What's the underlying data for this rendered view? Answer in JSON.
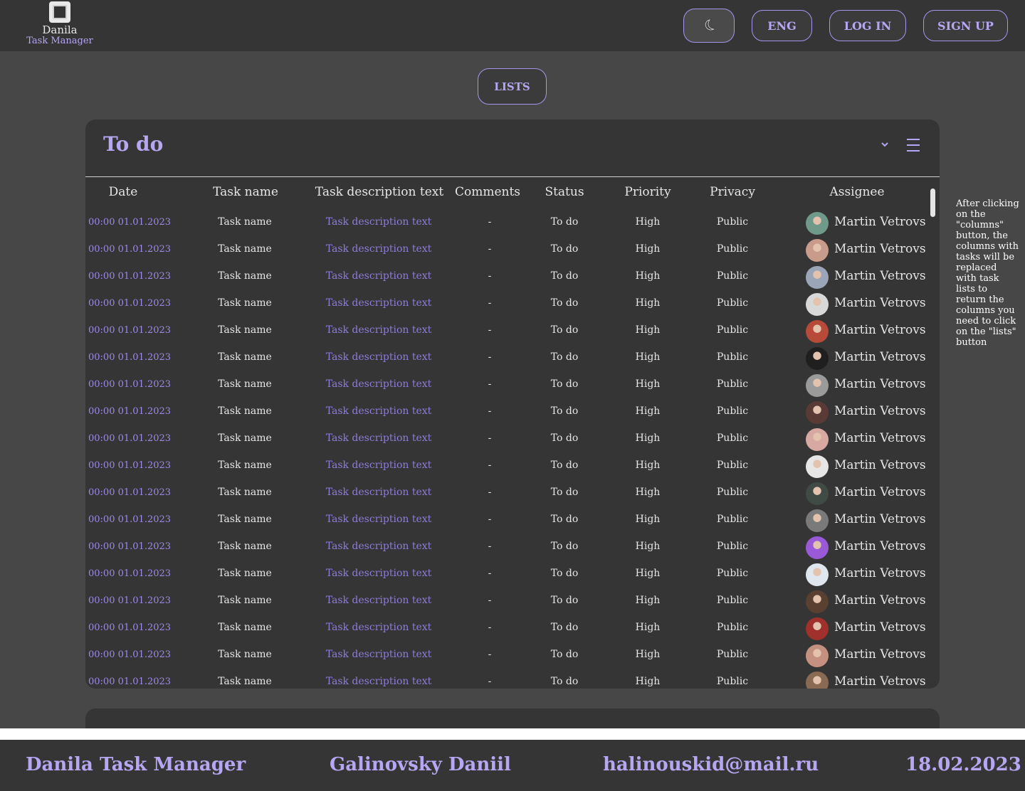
{
  "header": {
    "logo_name": "Danila",
    "logo_sub": "Task Manager",
    "lang_label": "ENG",
    "login_label": "LOG IN",
    "signup_label": "SIGN UP",
    "theme_icon": "moon-icon"
  },
  "lists_button": "LISTS",
  "panel": {
    "title": "To do",
    "columns": {
      "date": "Date",
      "name": "Task name",
      "desc": "Task description text",
      "comments": "Comments",
      "status": "Status",
      "priority": "Priority",
      "privacy": "Privacy",
      "assignee": "Assignee"
    },
    "rows": [
      {
        "date": "00:00 01.01.2023",
        "name": "Task name",
        "desc": "Task description text",
        "comments": "-",
        "status": "To do",
        "priority": "High",
        "privacy": "Public",
        "assignee": "Martin Vetrovs",
        "avatar_color": "#6f9a8a"
      },
      {
        "date": "00:00 01.01.2023",
        "name": "Task name",
        "desc": "Task description text",
        "comments": "-",
        "status": "To do",
        "priority": "High",
        "privacy": "Public",
        "assignee": "Martin Vetrovs",
        "avatar_color": "#c99b8a"
      },
      {
        "date": "00:00 01.01.2023",
        "name": "Task name",
        "desc": "Task description text",
        "comments": "-",
        "status": "To do",
        "priority": "High",
        "privacy": "Public",
        "assignee": "Martin Vetrovs",
        "avatar_color": "#9aa6b8"
      },
      {
        "date": "00:00 01.01.2023",
        "name": "Task name",
        "desc": "Task description text",
        "comments": "-",
        "status": "To do",
        "priority": "High",
        "privacy": "Public",
        "assignee": "Martin Vetrovs",
        "avatar_color": "#d8d8d8"
      },
      {
        "date": "00:00 01.01.2023",
        "name": "Task name",
        "desc": "Task description text",
        "comments": "-",
        "status": "To do",
        "priority": "High",
        "privacy": "Public",
        "assignee": "Martin Vetrovs",
        "avatar_color": "#b84a3a"
      },
      {
        "date": "00:00 01.01.2023",
        "name": "Task name",
        "desc": "Task description text",
        "comments": "-",
        "status": "To do",
        "priority": "High",
        "privacy": "Public",
        "assignee": "Martin Vetrovs",
        "avatar_color": "#1f1f1f"
      },
      {
        "date": "00:00 01.01.2023",
        "name": "Task name",
        "desc": "Task description text",
        "comments": "-",
        "status": "To do",
        "priority": "High",
        "privacy": "Public",
        "assignee": "Martin Vetrovs",
        "avatar_color": "#9a9a9a"
      },
      {
        "date": "00:00 01.01.2023",
        "name": "Task name",
        "desc": "Task description text",
        "comments": "-",
        "status": "To do",
        "priority": "High",
        "privacy": "Public",
        "assignee": "Martin Vetrovs",
        "avatar_color": "#5a3a34"
      },
      {
        "date": "00:00 01.01.2023",
        "name": "Task name",
        "desc": "Task description text",
        "comments": "-",
        "status": "To do",
        "priority": "High",
        "privacy": "Public",
        "assignee": "Martin Vetrovs",
        "avatar_color": "#d7a9a2"
      },
      {
        "date": "00:00 01.01.2023",
        "name": "Task name",
        "desc": "Task description text",
        "comments": "-",
        "status": "To do",
        "priority": "High",
        "privacy": "Public",
        "assignee": "Martin Vetrovs",
        "avatar_color": "#e6e6e6"
      },
      {
        "date": "00:00 01.01.2023",
        "name": "Task name",
        "desc": "Task description text",
        "comments": "-",
        "status": "To do",
        "priority": "High",
        "privacy": "Public",
        "assignee": "Martin Vetrovs",
        "avatar_color": "#3f4b44"
      },
      {
        "date": "00:00 01.01.2023",
        "name": "Task name",
        "desc": "Task description text",
        "comments": "-",
        "status": "To do",
        "priority": "High",
        "privacy": "Public",
        "assignee": "Martin Vetrovs",
        "avatar_color": "#7a7a7a"
      },
      {
        "date": "00:00 01.01.2023",
        "name": "Task name",
        "desc": "Task description text",
        "comments": "-",
        "status": "To do",
        "priority": "High",
        "privacy": "Public",
        "assignee": "Martin Vetrovs",
        "avatar_color": "#9a5ad8"
      },
      {
        "date": "00:00 01.01.2023",
        "name": "Task name",
        "desc": "Task description text",
        "comments": "-",
        "status": "To do",
        "priority": "High",
        "privacy": "Public",
        "assignee": "Martin Vetrovs",
        "avatar_color": "#dfe6ee"
      },
      {
        "date": "00:00 01.01.2023",
        "name": "Task name",
        "desc": "Task description text",
        "comments": "-",
        "status": "To do",
        "priority": "High",
        "privacy": "Public",
        "assignee": "Martin Vetrovs",
        "avatar_color": "#5a4030"
      },
      {
        "date": "00:00 01.01.2023",
        "name": "Task name",
        "desc": "Task description text",
        "comments": "-",
        "status": "To do",
        "priority": "High",
        "privacy": "Public",
        "assignee": "Martin Vetrovs",
        "avatar_color": "#a0302c"
      },
      {
        "date": "00:00 01.01.2023",
        "name": "Task name",
        "desc": "Task description text",
        "comments": "-",
        "status": "To do",
        "priority": "High",
        "privacy": "Public",
        "assignee": "Martin Vetrovs",
        "avatar_color": "#c49080"
      },
      {
        "date": "00:00 01.01.2023",
        "name": "Task name",
        "desc": "Task description text",
        "comments": "-",
        "status": "To do",
        "priority": "High",
        "privacy": "Public",
        "assignee": "Martin Vetrovs",
        "avatar_color": "#8a6a50"
      }
    ]
  },
  "note": "After clicking on the \"columns\" button, the columns with tasks will be replaced with task lists to return the columns you need to click on the \"lists\" button",
  "footer": {
    "app": "Danila Task Manager",
    "author": "Galinovsky Daniil",
    "email": "halinouskid@mail.ru",
    "date": "18.02.2023"
  },
  "colors": {
    "accent": "#b7a6f2",
    "background": "#474747",
    "panel": "#353535"
  }
}
